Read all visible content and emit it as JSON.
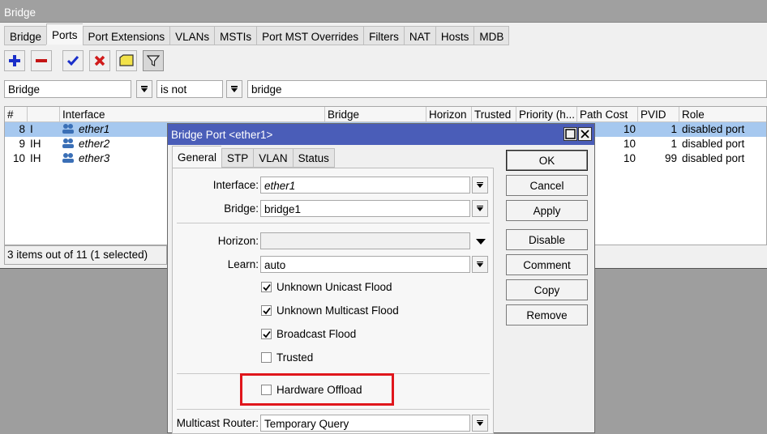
{
  "window": {
    "title": "Bridge"
  },
  "tabs": [
    {
      "label": "Bridge",
      "active": false
    },
    {
      "label": "Ports",
      "active": true
    },
    {
      "label": "Port Extensions",
      "active": false
    },
    {
      "label": "VLANs",
      "active": false
    },
    {
      "label": "MSTIs",
      "active": false
    },
    {
      "label": "Port MST Overrides",
      "active": false
    },
    {
      "label": "Filters",
      "active": false
    },
    {
      "label": "NAT",
      "active": false
    },
    {
      "label": "Hosts",
      "active": false
    },
    {
      "label": "MDB",
      "active": false
    }
  ],
  "toolbar": {
    "icons": [
      "add-icon",
      "remove-icon",
      "enable-icon",
      "disable-icon",
      "comment-icon",
      "filter-icon"
    ],
    "colors": {
      "add": "#1a2fc9",
      "remove": "#c41414",
      "enable": "#1a2fc9",
      "disable": "#d01a1a",
      "comment": "#f2e24a"
    }
  },
  "filter": {
    "field": "Bridge",
    "operator": "is not",
    "value": "bridge"
  },
  "table": {
    "columns": [
      "#",
      "",
      "Interface",
      "Bridge",
      "Horizon",
      "Trusted",
      "Priority (h...",
      "Path Cost",
      "PVID",
      "Role"
    ],
    "rows": [
      {
        "num": "8",
        "flags": "I",
        "iface": "ether1",
        "path_cost": "10",
        "pvid": "1",
        "role": "disabled port",
        "selected": true
      },
      {
        "num": "9",
        "flags": "IH",
        "iface": "ether2",
        "path_cost": "10",
        "pvid": "1",
        "role": "disabled port",
        "selected": false
      },
      {
        "num": "10",
        "flags": "IH",
        "iface": "ether3",
        "path_cost": "10",
        "pvid": "99",
        "role": "disabled port",
        "selected": false
      }
    ]
  },
  "status": "3 items out of 11 (1 selected)",
  "dialog": {
    "title": "Bridge Port <ether1>",
    "tabs": [
      "General",
      "STP",
      "VLAN",
      "Status"
    ],
    "interface_label": "Interface:",
    "interface_value": "ether1",
    "bridge_label": "Bridge:",
    "bridge_value": "bridge1",
    "horizon_label": "Horizon:",
    "horizon_value": "",
    "learn_label": "Learn:",
    "learn_value": "auto",
    "checkboxes": [
      {
        "label": "Unknown Unicast Flood",
        "checked": true
      },
      {
        "label": "Unknown Multicast Flood",
        "checked": true
      },
      {
        "label": "Broadcast Flood",
        "checked": true
      },
      {
        "label": "Trusted",
        "checked": false
      }
    ],
    "hw_offload": {
      "label": "Hardware Offload",
      "checked": false
    },
    "mcast_label": "Multicast Router:",
    "mcast_value": "Temporary Query",
    "buttons": [
      "OK",
      "Cancel",
      "Apply",
      "Disable",
      "Comment",
      "Copy",
      "Remove"
    ],
    "title_color": "#4a5db8",
    "highlight_color": "#e0161c"
  }
}
